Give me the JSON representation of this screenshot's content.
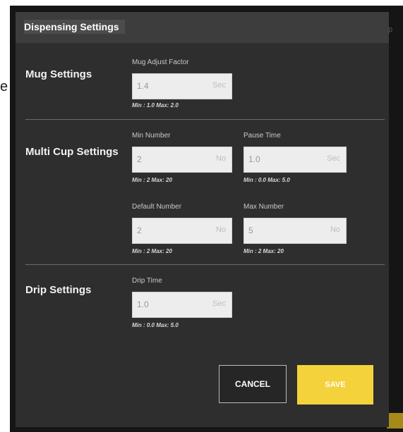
{
  "background": {
    "peek_text_right": "p",
    "peek_text_left": "e"
  },
  "dialog": {
    "title": "Dispensing Settings",
    "sections": {
      "mug": {
        "label": "Mug Settings",
        "fields": {
          "mug_adjust_factor": {
            "label": "Mug Adjust Factor",
            "value": "1.4",
            "unit": "Sec",
            "hint": "Min : 1.0 Max: 2.0"
          }
        }
      },
      "multi_cup": {
        "label": "Multi Cup Settings",
        "fields": {
          "min_number": {
            "label": "Min Number",
            "value": "2",
            "unit": "No",
            "hint": "Min : 2 Max: 20"
          },
          "pause_time": {
            "label": "Pause Time",
            "value": "1.0",
            "unit": "Sec",
            "hint": "Min : 0.0 Max: 5.0"
          },
          "default_number": {
            "label": "Default Number",
            "value": "2",
            "unit": "No",
            "hint": "Min : 2 Max: 20"
          },
          "max_number": {
            "label": "Max Number",
            "value": "5",
            "unit": "No",
            "hint": "Min : 2 Max: 20"
          }
        }
      },
      "drip": {
        "label": "Drip Settings",
        "fields": {
          "drip_time": {
            "label": "Drip Time",
            "value": "1.0",
            "unit": "Sec",
            "hint": "Min : 0.0 Max: 5.0"
          }
        }
      }
    },
    "buttons": {
      "cancel": "CANCEL",
      "save": "SAVE"
    }
  },
  "colors": {
    "accent": "#f4d23c",
    "dialog_bg": "#2e2e2e",
    "header_bg": "#3d3d3d"
  }
}
